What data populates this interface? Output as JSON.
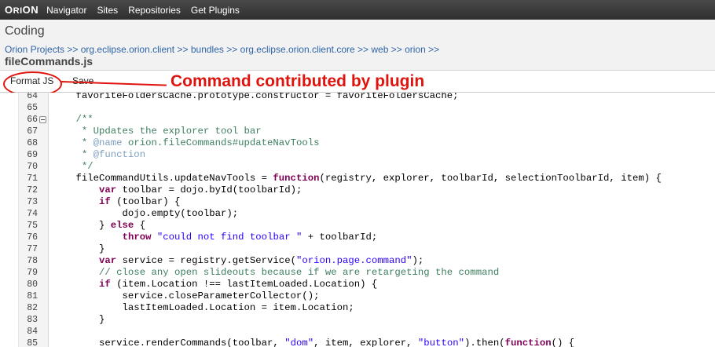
{
  "header": {
    "logo_main": "ORI",
    "logo_o": "O",
    "logo_n": "N",
    "nav": [
      "Navigator",
      "Sites",
      "Repositories",
      "Get Plugins"
    ]
  },
  "title": {
    "page_title": "Coding",
    "breadcrumb": [
      "Orion Projects",
      "org.eclipse.orion.client",
      "bundles",
      "org.eclipse.orion.client.core",
      "web",
      "orion"
    ],
    "breadcrumb_sep": ">>",
    "file_name": "fileCommands.js"
  },
  "toolbar": {
    "format_label": "Format JS",
    "save_label": "Save"
  },
  "annotation": {
    "text": "Command contributed by plugin",
    "color": "#e0140e"
  },
  "editor": {
    "lines": [
      {
        "n": "64",
        "t": "    favoriteFoldersCache.prototype.constructor = favoriteFoldersCache;"
      },
      {
        "n": "65",
        "t": ""
      },
      {
        "n": "66",
        "t": "    /**",
        "fold": true
      },
      {
        "n": "67",
        "t": "     * Updates the explorer tool bar"
      },
      {
        "n": "68",
        "t": "     * @name orion.fileCommands#updateNavTools"
      },
      {
        "n": "69",
        "t": "     * @function"
      },
      {
        "n": "70",
        "t": "     */"
      },
      {
        "n": "71",
        "t": "    fileCommandUtils.updateNavTools = function(registry, explorer, toolbarId, selectionToolbarId, item) {"
      },
      {
        "n": "72",
        "t": "        var toolbar = dojo.byId(toolbarId);"
      },
      {
        "n": "73",
        "t": "        if (toolbar) {"
      },
      {
        "n": "74",
        "t": "            dojo.empty(toolbar);"
      },
      {
        "n": "75",
        "t": "        } else {"
      },
      {
        "n": "76",
        "t": "            throw \"could not find toolbar \" + toolbarId;"
      },
      {
        "n": "77",
        "t": "        }"
      },
      {
        "n": "78",
        "t": "        var service = registry.getService(\"orion.page.command\");"
      },
      {
        "n": "79",
        "t": "        // close any open slideouts because if we are retargeting the command"
      },
      {
        "n": "80",
        "t": "        if (item.Location !== lastItemLoaded.Location) {"
      },
      {
        "n": "81",
        "t": "            service.closeParameterCollector();"
      },
      {
        "n": "82",
        "t": "            lastItemLoaded.Location = item.Location;"
      },
      {
        "n": "83",
        "t": "        }"
      },
      {
        "n": "84",
        "t": ""
      },
      {
        "n": "85",
        "t": "        service.renderCommands(toolbar, \"dom\", item, explorer, \"button\").then(function() {"
      }
    ]
  }
}
